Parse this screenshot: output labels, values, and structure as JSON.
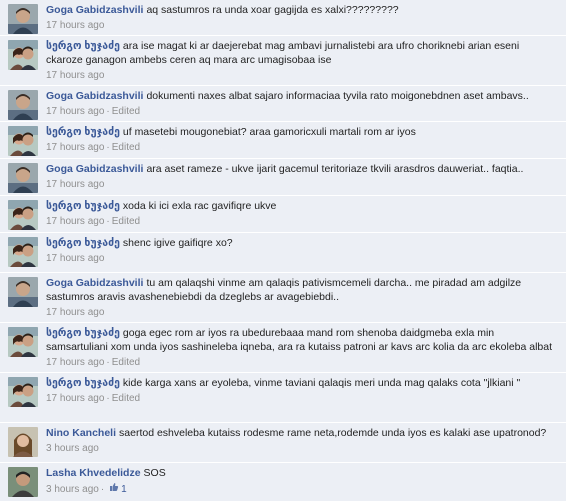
{
  "comments": [
    {
      "author": "Goga Gabidzashvili",
      "text": "aq sastumros ra unda xoar gagijda es xalxi?????????",
      "time": "17 hours ago",
      "edited": "",
      "avatar": "man"
    },
    {
      "author": "სერგო ხუჯაძე",
      "text": "ara ise magat ki ar daejerebat mag ambavi jurnalistebi ara ufro choriknebi arian eseni ckaroze ganagon ambebs ceren aq mara arc umagisobaa ise",
      "time": "17 hours ago",
      "edited": "",
      "avatar": "couple"
    },
    {
      "author": "Goga Gabidzashvili",
      "text": "dokumenti naxes albat sajaro informaciaa tyvila rato moigonebdnen aset ambavs..",
      "time": "17 hours ago",
      "edited": "Edited",
      "avatar": "man"
    },
    {
      "author": "სერგო ხუჯაძე",
      "text": "uf masetebi mougonebiat? araa gamoricxuli martali rom ar iyos",
      "time": "17 hours ago",
      "edited": "Edited",
      "avatar": "couple"
    },
    {
      "author": "Goga Gabidzashvili",
      "text": "ara aset rameze - ukve ijarit gacemul teritoriaze tkvili arasdros dauweriat.. faqtia..",
      "time": "17 hours ago",
      "edited": "",
      "avatar": "man"
    },
    {
      "author": "სერგო ხუჯაძე",
      "text": "xoda ki ici exla rac gavifiqre ukve",
      "time": "17 hours ago",
      "edited": "Edited",
      "avatar": "couple"
    },
    {
      "author": "სერგო ხუჯაძე",
      "text": "shenc igive gaifiqre xo?",
      "time": "17 hours ago",
      "edited": "",
      "avatar": "couple"
    },
    {
      "author": "Goga Gabidzashvili",
      "text": "tu am qalaqshi vinme am qalaqis pativismcemeli darcha.. me piradad am adgilze sastumros aravis avashenebiebdi da dzeglebs ar avagebiebdi..",
      "time": "17 hours ago",
      "edited": "",
      "avatar": "man"
    },
    {
      "author": "სერგო ხუჯაძე",
      "text": "goga egec rom ar iyos ra ubedurebaaa mand rom shenoba daidgmeba exla min samsartuliani xom unda iyos sashineleba iqneba, ara ra kutaiss patroni ar kavs arc kolia da arc ekoleba albat",
      "time": "17 hours ago",
      "edited": "Edited",
      "avatar": "couple"
    },
    {
      "author": "სერგო ხუჯაძე",
      "text": "kide karga xans ar eyoleba, vinme taviani qalaqis meri unda mag qalaks cota \"jlkiani \"",
      "time": "17 hours ago",
      "edited": "Edited",
      "avatar": "couple"
    },
    {
      "author": "Nino Kancheli",
      "text": "saertod eshveleba kutaiss rodesme rame neta,rodemde unda iyos es kalaki ase upatronod?",
      "time": "3 hours ago",
      "edited": "",
      "avatar": "woman"
    },
    {
      "author": "Lasha Khvedelidze",
      "text": "SOS",
      "time": "3 hours ago",
      "edited": "",
      "avatar": "man2",
      "likes": "1"
    }
  ],
  "colors": {
    "link": "#3b5998",
    "background": "#eceff5",
    "meta": "#8f8f8f"
  }
}
